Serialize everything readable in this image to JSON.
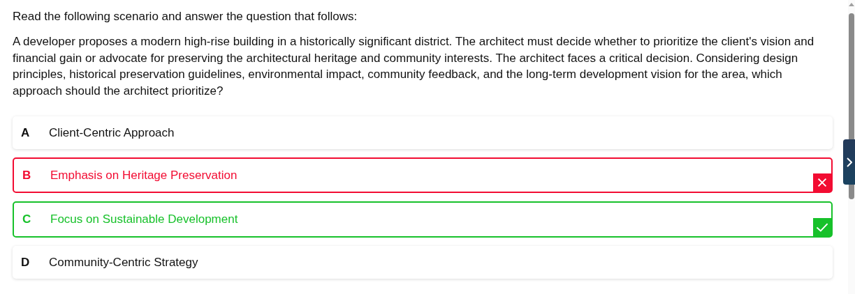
{
  "instruction": "Read the following scenario and answer the question that follows:",
  "scenario": "A developer proposes a modern high-rise building in a historically significant district. The architect must decide whether to prioritize the client's vision and financial gain or advocate for preserving the architectural heritage and community interests. The architect faces a critical decision. Considering design principles, historical preservation guidelines, environmental impact, community feedback, and the long-term development vision for the area, which approach should the architect prioritize?",
  "options": [
    {
      "letter": "A",
      "text": "Client-Centric Approach",
      "selected": false,
      "correct": false
    },
    {
      "letter": "B",
      "text": "Emphasis on Heritage Preservation",
      "selected": true,
      "correct": false
    },
    {
      "letter": "C",
      "text": "Focus on Sustainable Development",
      "selected": false,
      "correct": true
    },
    {
      "letter": "D",
      "text": "Community-Centric Strategy",
      "selected": false,
      "correct": false
    }
  ]
}
